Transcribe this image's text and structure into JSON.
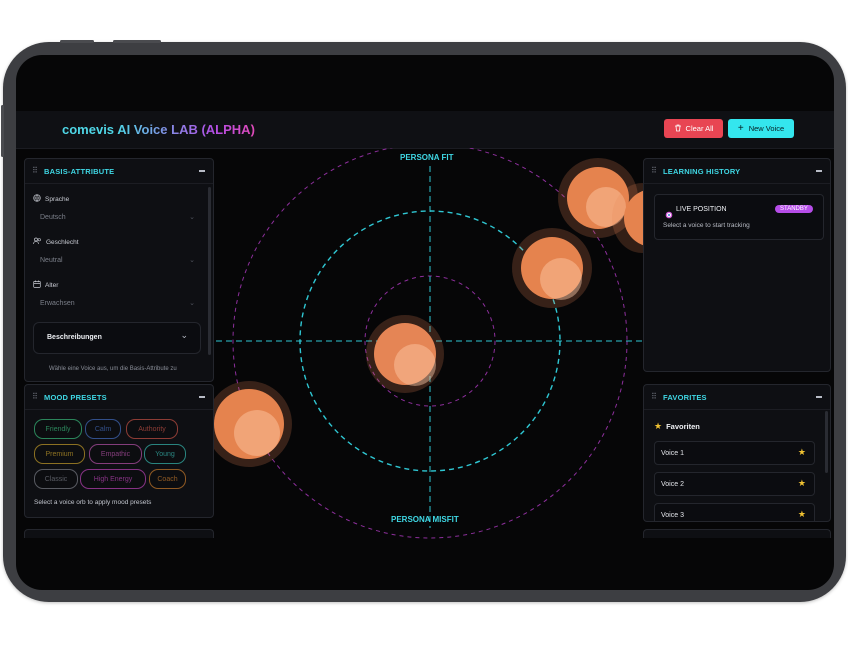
{
  "app": {
    "title_brand": "comevis",
    "title_rest": "AI Voice LAB (ALPHA)",
    "clear_all_label": "Clear All",
    "new_voice_label": "New Voice"
  },
  "basis": {
    "title": "BASIS-ATTRIBUTE",
    "sprache_label": "Sprache",
    "sprache_value": "Deutsch",
    "geschlecht_label": "Geschlecht",
    "geschlecht_value": "Neutral",
    "alter_label": "Alter",
    "alter_value": "Erwachsen",
    "beschreibungen_label": "Beschreibungen",
    "hint": "Wähle eine Voice aus, um die Basis-Attribute zu"
  },
  "mood": {
    "title": "MOOD PRESETS",
    "presets": [
      {
        "label": "Friendly",
        "color": "#3fd48a"
      },
      {
        "label": "Calm",
        "color": "#4b7bd9"
      },
      {
        "label": "Authority",
        "color": "#e25b4c"
      },
      {
        "label": "Premium",
        "color": "#e0b32c"
      },
      {
        "label": "Empathic",
        "color": "#d25cc0"
      },
      {
        "label": "Young",
        "color": "#3cd3c7"
      },
      {
        "label": "Classic",
        "color": "#8a8d96"
      },
      {
        "label": "High Energy",
        "color": "#d64ad0"
      },
      {
        "label": "Coach",
        "color": "#e58b2e"
      }
    ],
    "hint": "Select a voice orb to apply mood presets"
  },
  "map": {
    "top_label": "PERSONA FIT",
    "bottom_label": "PERSONA MISFIT"
  },
  "history": {
    "title": "LEARNING HISTORY",
    "live_label": "LIVE POSITION",
    "status_badge": "STANDBY",
    "hint": "Select a voice to start tracking"
  },
  "favorites": {
    "title": "FAVORITES",
    "heading": "Favoriten",
    "items": [
      "Voice 1",
      "Voice 2",
      "Voice 3"
    ]
  },
  "colors": {
    "accent_cyan": "#34e6ee",
    "danger_red": "#e84553",
    "orb_orange": "#e98555",
    "badge_purple": "#b64de8"
  }
}
